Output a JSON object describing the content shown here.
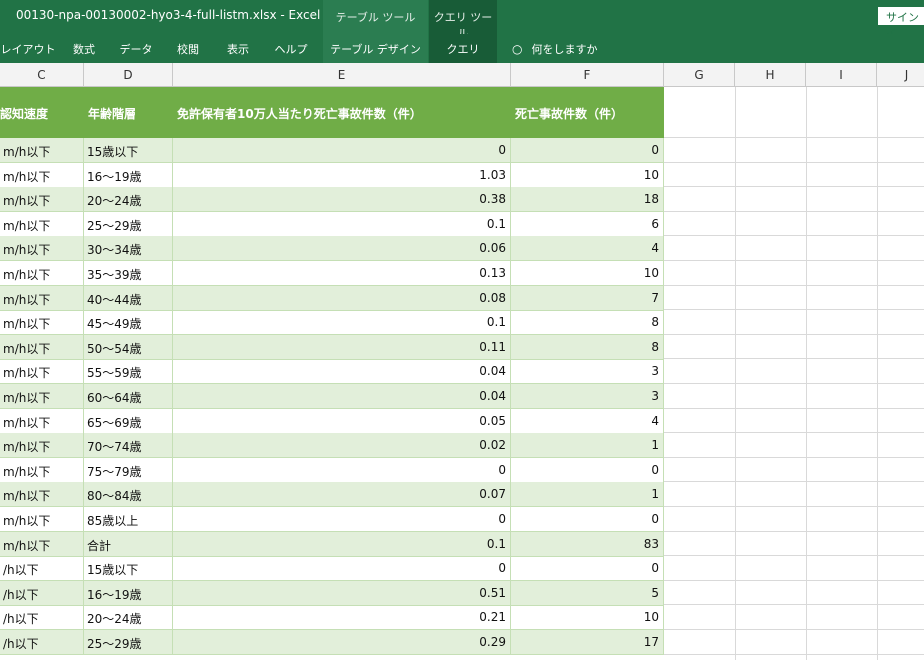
{
  "window": {
    "title": "00130-npa-00130002-hyo3-4-full-listm.xlsx  -  Excel",
    "context_tab_table": "テーブル ツール",
    "context_tab_query": "クエリ ツール",
    "signin": "サインイ"
  },
  "ribbon": {
    "tabs": [
      "レイアウト",
      "数式",
      "データ",
      "校閲",
      "表示",
      "ヘルプ",
      "テーブル デザイン",
      "クエリ"
    ],
    "tell_me": "何をしますか"
  },
  "columns": [
    "C",
    "D",
    "E",
    "F",
    "G",
    "H",
    "I",
    "J"
  ],
  "table": {
    "headers": [
      "認知速度",
      "年齢階層",
      "免許保有者10万人当たり死亡事故件数（件）",
      "死亡事故件数（件）"
    ],
    "rows": [
      [
        "m/h以下",
        "15歳以下",
        "0",
        "0"
      ],
      [
        "m/h以下",
        "16～19歳",
        "1.03",
        "10"
      ],
      [
        "m/h以下",
        "20～24歳",
        "0.38",
        "18"
      ],
      [
        "m/h以下",
        "25～29歳",
        "0.1",
        "6"
      ],
      [
        "m/h以下",
        "30～34歳",
        "0.06",
        "4"
      ],
      [
        "m/h以下",
        "35～39歳",
        "0.13",
        "10"
      ],
      [
        "m/h以下",
        "40～44歳",
        "0.08",
        "7"
      ],
      [
        "m/h以下",
        "45～49歳",
        "0.1",
        "8"
      ],
      [
        "m/h以下",
        "50～54歳",
        "0.11",
        "8"
      ],
      [
        "m/h以下",
        "55～59歳",
        "0.04",
        "3"
      ],
      [
        "m/h以下",
        "60～64歳",
        "0.04",
        "3"
      ],
      [
        "m/h以下",
        "65～69歳",
        "0.05",
        "4"
      ],
      [
        "m/h以下",
        "70～74歳",
        "0.02",
        "1"
      ],
      [
        "m/h以下",
        "75～79歳",
        "0",
        "0"
      ],
      [
        "m/h以下",
        "80～84歳",
        "0.07",
        "1"
      ],
      [
        "m/h以下",
        "85歳以上",
        "0",
        "0"
      ],
      [
        "m/h以下",
        "合計",
        "0.1",
        "83"
      ],
      [
        "/h以下",
        "15歳以下",
        "0",
        "0"
      ],
      [
        "/h以下",
        "16～19歳",
        "0.51",
        "5"
      ],
      [
        "/h以下",
        "20～24歳",
        "0.21",
        "10"
      ],
      [
        "/h以下",
        "25～29歳",
        "0.29",
        "17"
      ]
    ]
  }
}
